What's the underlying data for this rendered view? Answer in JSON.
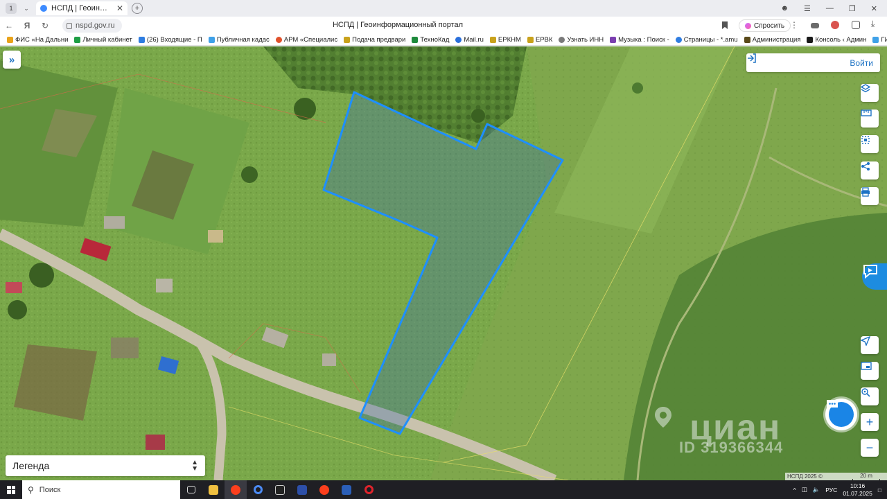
{
  "browser": {
    "tab_count": "1",
    "tab_title": "НСПД | Геоинформационный портал",
    "url": "nspd.gov.ru",
    "page_title": "НСПД | Геоинформационный портал",
    "ask_label": "Спросить"
  },
  "bookmarks": [
    {
      "label": "ФИС «На Дальни",
      "color": "#e9a31b"
    },
    {
      "label": "Личный кабинет",
      "color": "#1f9e45"
    },
    {
      "label": "(26) Входящие - П",
      "color": "#2f7de1"
    },
    {
      "label": "Публичная кадас",
      "color": "#3fa1e8"
    },
    {
      "label": "АРМ «Специалис",
      "color": "#e0512b"
    },
    {
      "label": "Подача предвари",
      "color": "#c9a21c"
    },
    {
      "label": "ТехноКад",
      "color": "#1e8a3c"
    },
    {
      "label": "Mail.ru",
      "color": "#2a6fdb"
    },
    {
      "label": "ЕРКНМ",
      "color": "#c9a21c"
    },
    {
      "label": "ЕРВК",
      "color": "#c9a21c"
    },
    {
      "label": "Узнать ИНН",
      "color": "#7a7a7a"
    },
    {
      "label": "Музыка : Поиск -",
      "color": "#7b3fb0"
    },
    {
      "label": "Страницы - *.amu",
      "color": "#2f7de1"
    },
    {
      "label": "Администрация",
      "color": "#5a4a1a"
    },
    {
      "label": "Консоль ‹ Админ",
      "color": "#1a1a1a"
    },
    {
      "label": "ГИС",
      "color": "#3fa1e8"
    }
  ],
  "map": {
    "login_label": "Войти",
    "legend_label": "Легенда",
    "attribution": "НСПД 2025 ©",
    "scale_label": "20 m",
    "watermark_brand": "циан",
    "watermark_id": "ID 319366344",
    "parcel_color": "#1e8fff"
  },
  "taskbar": {
    "search_placeholder": "Поиск",
    "lang": "РУС",
    "time": "10:16",
    "date": "01.07.2025"
  }
}
